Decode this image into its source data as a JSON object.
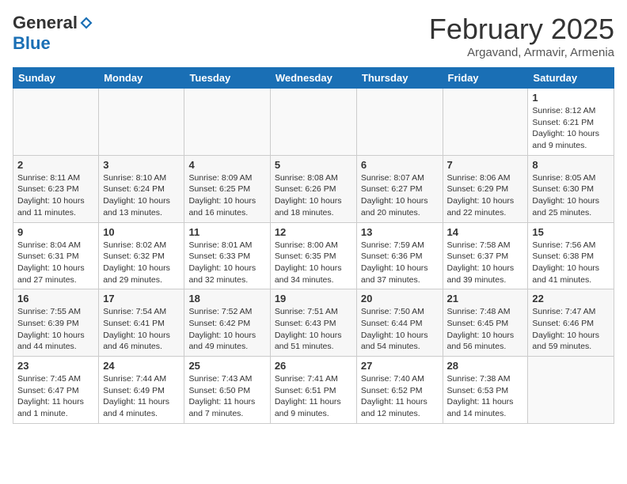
{
  "logo": {
    "general": "General",
    "blue": "Blue"
  },
  "header": {
    "month": "February 2025",
    "location": "Argavand, Armavir, Armenia"
  },
  "days_of_week": [
    "Sunday",
    "Monday",
    "Tuesday",
    "Wednesday",
    "Thursday",
    "Friday",
    "Saturday"
  ],
  "weeks": [
    [
      {
        "day": "",
        "info": ""
      },
      {
        "day": "",
        "info": ""
      },
      {
        "day": "",
        "info": ""
      },
      {
        "day": "",
        "info": ""
      },
      {
        "day": "",
        "info": ""
      },
      {
        "day": "",
        "info": ""
      },
      {
        "day": "1",
        "info": "Sunrise: 8:12 AM\nSunset: 6:21 PM\nDaylight: 10 hours and 9 minutes."
      }
    ],
    [
      {
        "day": "2",
        "info": "Sunrise: 8:11 AM\nSunset: 6:23 PM\nDaylight: 10 hours and 11 minutes."
      },
      {
        "day": "3",
        "info": "Sunrise: 8:10 AM\nSunset: 6:24 PM\nDaylight: 10 hours and 13 minutes."
      },
      {
        "day": "4",
        "info": "Sunrise: 8:09 AM\nSunset: 6:25 PM\nDaylight: 10 hours and 16 minutes."
      },
      {
        "day": "5",
        "info": "Sunrise: 8:08 AM\nSunset: 6:26 PM\nDaylight: 10 hours and 18 minutes."
      },
      {
        "day": "6",
        "info": "Sunrise: 8:07 AM\nSunset: 6:27 PM\nDaylight: 10 hours and 20 minutes."
      },
      {
        "day": "7",
        "info": "Sunrise: 8:06 AM\nSunset: 6:29 PM\nDaylight: 10 hours and 22 minutes."
      },
      {
        "day": "8",
        "info": "Sunrise: 8:05 AM\nSunset: 6:30 PM\nDaylight: 10 hours and 25 minutes."
      }
    ],
    [
      {
        "day": "9",
        "info": "Sunrise: 8:04 AM\nSunset: 6:31 PM\nDaylight: 10 hours and 27 minutes."
      },
      {
        "day": "10",
        "info": "Sunrise: 8:02 AM\nSunset: 6:32 PM\nDaylight: 10 hours and 29 minutes."
      },
      {
        "day": "11",
        "info": "Sunrise: 8:01 AM\nSunset: 6:33 PM\nDaylight: 10 hours and 32 minutes."
      },
      {
        "day": "12",
        "info": "Sunrise: 8:00 AM\nSunset: 6:35 PM\nDaylight: 10 hours and 34 minutes."
      },
      {
        "day": "13",
        "info": "Sunrise: 7:59 AM\nSunset: 6:36 PM\nDaylight: 10 hours and 37 minutes."
      },
      {
        "day": "14",
        "info": "Sunrise: 7:58 AM\nSunset: 6:37 PM\nDaylight: 10 hours and 39 minutes."
      },
      {
        "day": "15",
        "info": "Sunrise: 7:56 AM\nSunset: 6:38 PM\nDaylight: 10 hours and 41 minutes."
      }
    ],
    [
      {
        "day": "16",
        "info": "Sunrise: 7:55 AM\nSunset: 6:39 PM\nDaylight: 10 hours and 44 minutes."
      },
      {
        "day": "17",
        "info": "Sunrise: 7:54 AM\nSunset: 6:41 PM\nDaylight: 10 hours and 46 minutes."
      },
      {
        "day": "18",
        "info": "Sunrise: 7:52 AM\nSunset: 6:42 PM\nDaylight: 10 hours and 49 minutes."
      },
      {
        "day": "19",
        "info": "Sunrise: 7:51 AM\nSunset: 6:43 PM\nDaylight: 10 hours and 51 minutes."
      },
      {
        "day": "20",
        "info": "Sunrise: 7:50 AM\nSunset: 6:44 PM\nDaylight: 10 hours and 54 minutes."
      },
      {
        "day": "21",
        "info": "Sunrise: 7:48 AM\nSunset: 6:45 PM\nDaylight: 10 hours and 56 minutes."
      },
      {
        "day": "22",
        "info": "Sunrise: 7:47 AM\nSunset: 6:46 PM\nDaylight: 10 hours and 59 minutes."
      }
    ],
    [
      {
        "day": "23",
        "info": "Sunrise: 7:45 AM\nSunset: 6:47 PM\nDaylight: 11 hours and 1 minute."
      },
      {
        "day": "24",
        "info": "Sunrise: 7:44 AM\nSunset: 6:49 PM\nDaylight: 11 hours and 4 minutes."
      },
      {
        "day": "25",
        "info": "Sunrise: 7:43 AM\nSunset: 6:50 PM\nDaylight: 11 hours and 7 minutes."
      },
      {
        "day": "26",
        "info": "Sunrise: 7:41 AM\nSunset: 6:51 PM\nDaylight: 11 hours and 9 minutes."
      },
      {
        "day": "27",
        "info": "Sunrise: 7:40 AM\nSunset: 6:52 PM\nDaylight: 11 hours and 12 minutes."
      },
      {
        "day": "28",
        "info": "Sunrise: 7:38 AM\nSunset: 6:53 PM\nDaylight: 11 hours and 14 minutes."
      },
      {
        "day": "",
        "info": ""
      }
    ]
  ]
}
